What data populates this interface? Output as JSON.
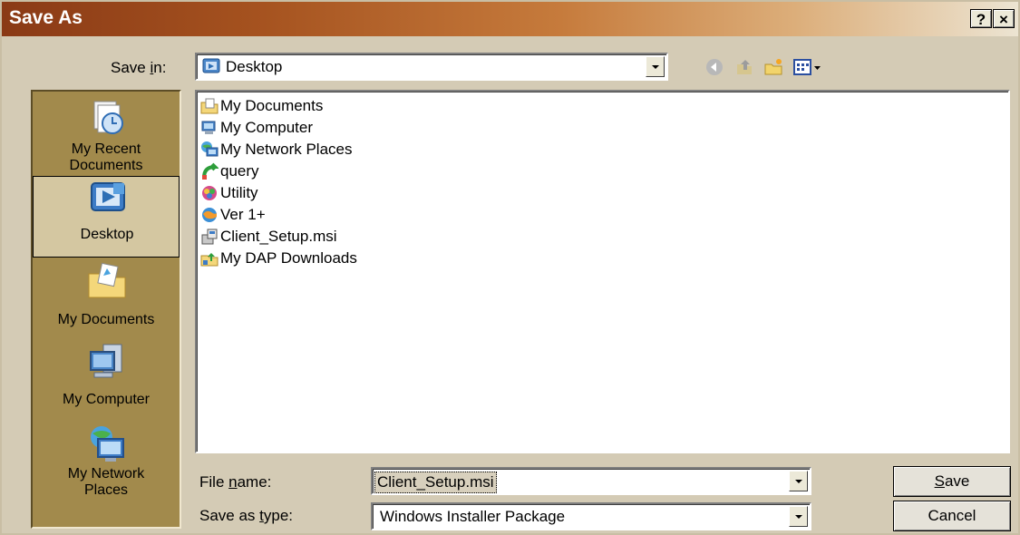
{
  "window": {
    "title": "Save As",
    "help_label": "?",
    "close_label": "×"
  },
  "toolbar": {
    "save_in_label_pre": "Save ",
    "save_in_label_accel": "i",
    "save_in_label_post": "n:",
    "save_in_value": "Desktop",
    "icons": [
      "back-icon",
      "up-folder-icon",
      "new-folder-icon",
      "view-menu-icon"
    ]
  },
  "places": [
    {
      "label": "My Recent\nDocuments",
      "icon": "recent-documents-icon",
      "selected": false
    },
    {
      "label": "Desktop",
      "icon": "desktop-icon",
      "selected": true
    },
    {
      "label": "My Documents",
      "icon": "my-documents-icon",
      "selected": false
    },
    {
      "label": "My Computer",
      "icon": "my-computer-icon",
      "selected": false
    },
    {
      "label": "My Network\nPlaces",
      "icon": "my-network-places-icon",
      "selected": false
    }
  ],
  "files": [
    {
      "name": "My Documents",
      "icon": "folder-documents-icon"
    },
    {
      "name": "My Computer",
      "icon": "computer-icon"
    },
    {
      "name": "My Network Places",
      "icon": "network-icon"
    },
    {
      "name": "query",
      "icon": "shortcut-green-icon"
    },
    {
      "name": "Utility",
      "icon": "utility-icon"
    },
    {
      "name": "Ver 1+",
      "icon": "globe-icon"
    },
    {
      "name": "Client_Setup.msi",
      "icon": "installer-icon"
    },
    {
      "name": "My DAP Downloads",
      "icon": "downloads-folder-icon"
    }
  ],
  "form": {
    "filename_label_pre": "File ",
    "filename_label_accel": "n",
    "filename_label_post": "ame:",
    "filename_value": "Client_Setup.msi",
    "type_label_pre": "Save as ",
    "type_label_accel": "t",
    "type_label_post": "ype:",
    "type_value": "Windows Installer Package"
  },
  "buttons": {
    "save_accel": "S",
    "save_rest": "ave",
    "cancel": "Cancel"
  },
  "colors": {
    "titlebar_start": "#8a3a16",
    "places_bg": "#a28a4c",
    "dialog_bg": "#d4cbb5",
    "selection": "#d4c7a1"
  }
}
